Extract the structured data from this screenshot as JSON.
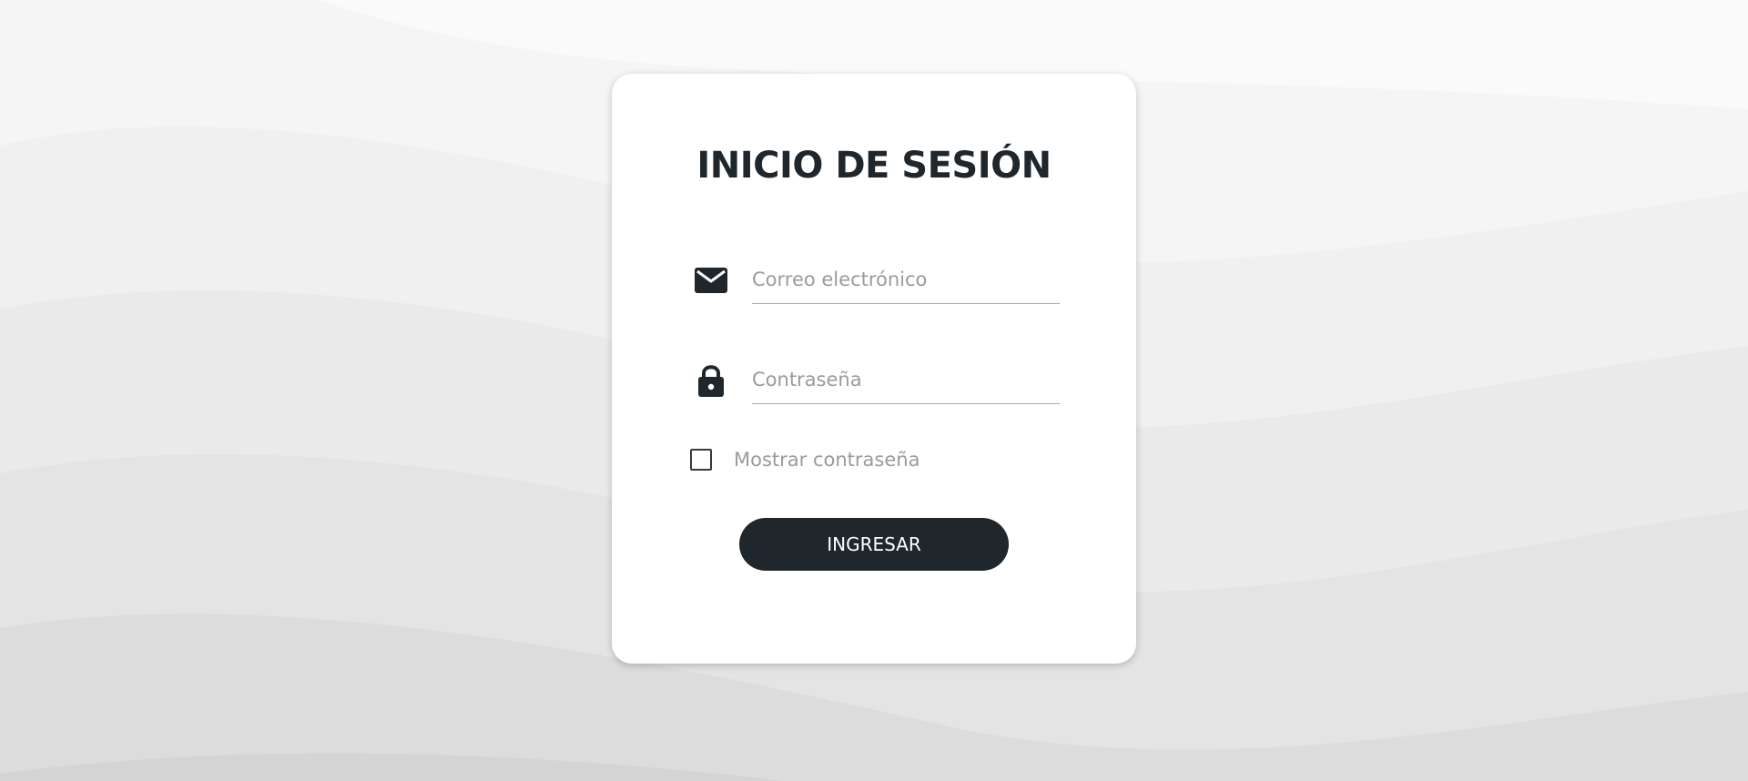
{
  "login": {
    "title": "INICIO DE SESIÓN",
    "email": {
      "placeholder": "Correo electrónico",
      "value": "",
      "icon": "envelope-icon"
    },
    "password": {
      "placeholder": "Contraseña",
      "value": "",
      "icon": "lock-icon"
    },
    "show_password": {
      "label": "Mostrar contraseña",
      "checked": false
    },
    "submit_label": "INGRESAR"
  },
  "colors": {
    "primary": "#1f272d",
    "card_background": "#ffffff",
    "page_background": "#f2f2f2",
    "placeholder": "#9b9b9b"
  }
}
